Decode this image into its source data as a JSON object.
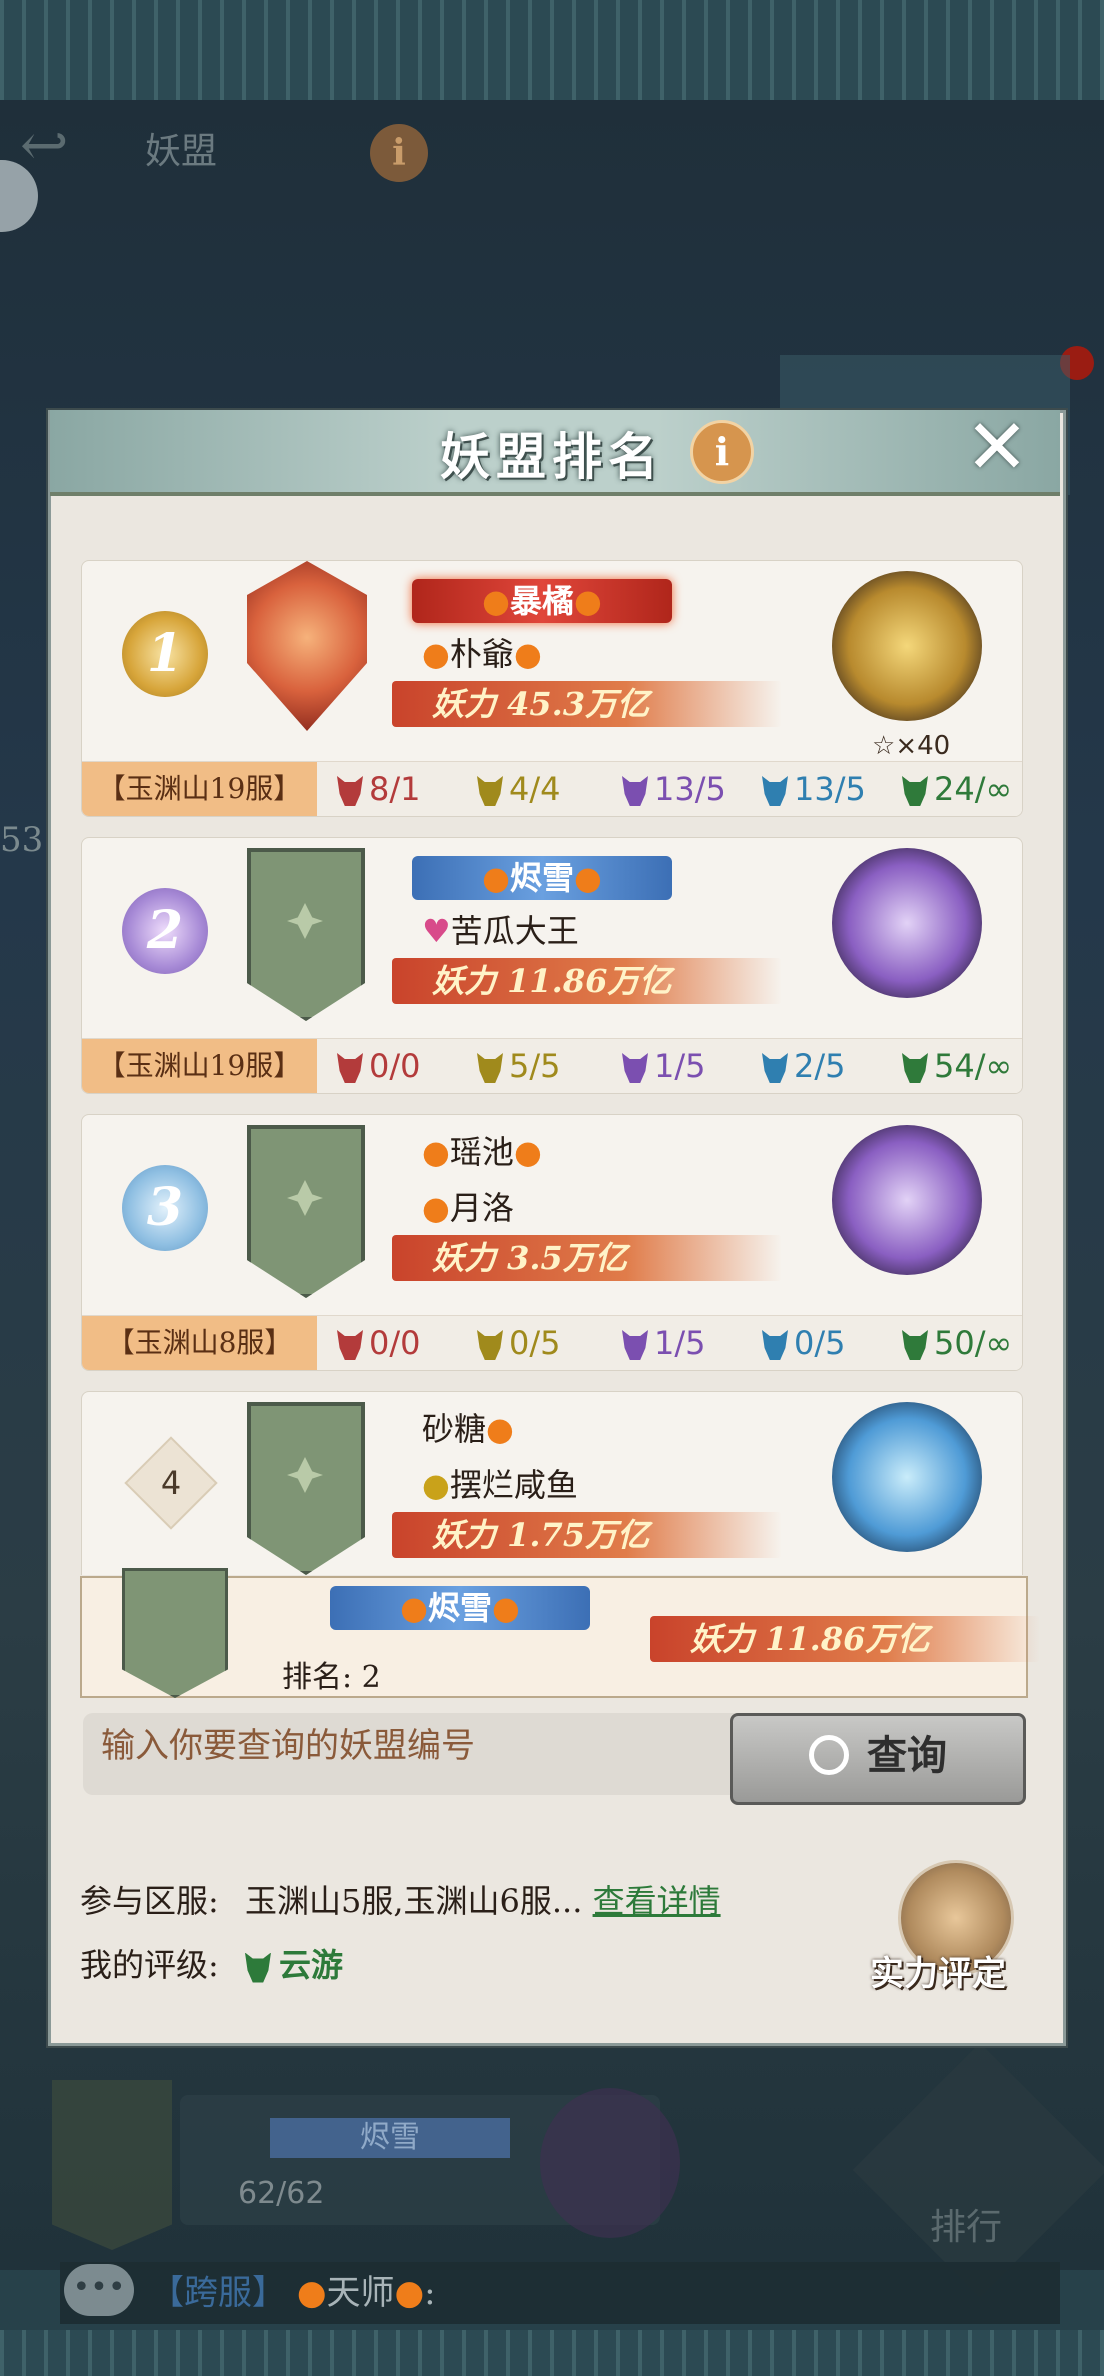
{
  "background": {
    "title": "妖盟",
    "left_number": "53",
    "alliance_name": "烬雪",
    "member_count": "62/62",
    "rank_button": "排行",
    "chat": {
      "tag": "【跨服】",
      "sender": "天师",
      "separator": ":"
    }
  },
  "modal": {
    "title": "妖盟排名",
    "info_label": "i",
    "close_label": "✕"
  },
  "rankings": [
    {
      "rank": "1",
      "alliance": "暴橘",
      "members": [
        "朴爺"
      ],
      "power": "妖力 45.3万亿",
      "stars": "×40",
      "server": "【玉渊山19服】",
      "stats": [
        "8/1",
        "4/4",
        "13/5",
        "13/5",
        "24/∞"
      ]
    },
    {
      "rank": "2",
      "alliance": "烬雪",
      "members": [
        "苦瓜大王"
      ],
      "power": "妖力 11.86万亿",
      "server": "【玉渊山19服】",
      "stats": [
        "0/0",
        "5/5",
        "1/5",
        "2/5",
        "54/∞"
      ]
    },
    {
      "rank": "3",
      "alliance": "",
      "members": [
        "瑶池",
        "月洛"
      ],
      "power": "妖力 3.5万亿",
      "server": "【玉渊山8服】",
      "stats": [
        "0/0",
        "0/5",
        "1/5",
        "0/5",
        "50/∞"
      ]
    },
    {
      "rank": "4",
      "alliance": "",
      "members": [
        "砂糖",
        "摆烂咸鱼"
      ],
      "power": "妖力 1.75万亿"
    }
  ],
  "stat_colors": [
    "#b33b3b",
    "#a08a1c",
    "#7b4fb0",
    "#2f7fb0",
    "#2f7a3a"
  ],
  "my_alliance": {
    "name": "烬雪",
    "rank_text": "排名: 2",
    "power": "妖力 11.86万亿"
  },
  "search": {
    "placeholder": "输入你要查询的妖盟编号",
    "button": "查询"
  },
  "footer": {
    "servers_label": "参与区服:",
    "servers_value": "玉渊山5服,玉渊山6服...",
    "details_link": "查看详情",
    "grade_label": "我的评级:",
    "grade_value": "云游",
    "eval_button": "实力评定"
  }
}
